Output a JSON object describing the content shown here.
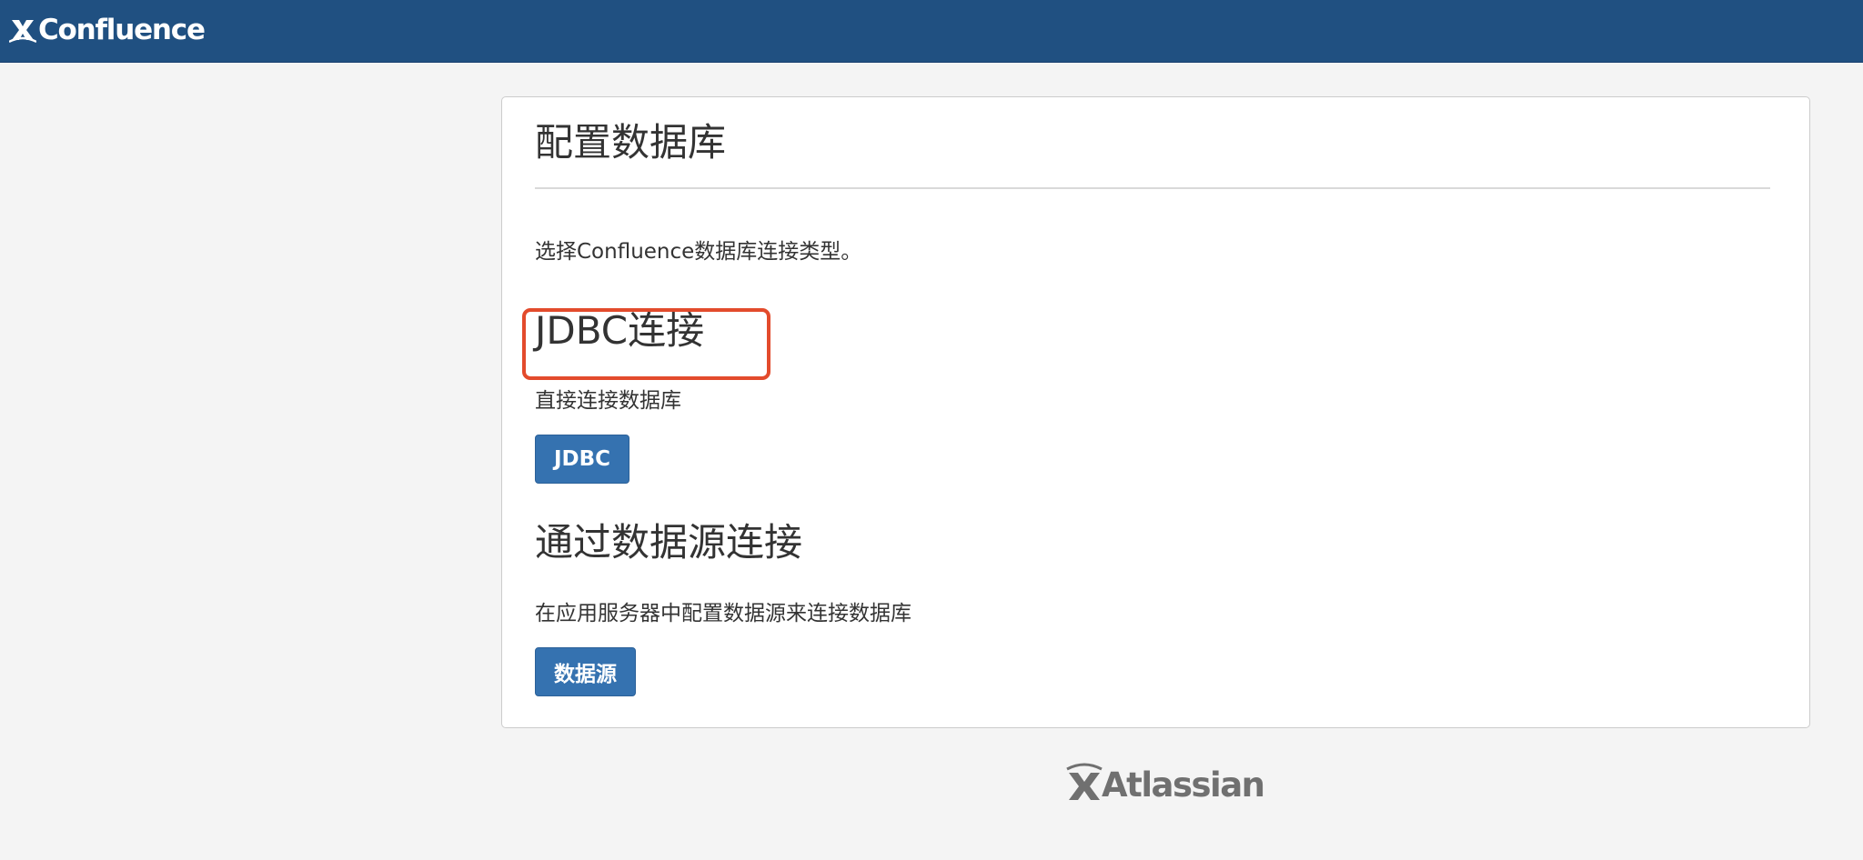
{
  "header": {
    "logo_text": "Confluence",
    "background_color": "#205081",
    "logo_icon": "confluence-x-icon"
  },
  "main": {
    "title": "配置数据库",
    "intro": "选择Confluence数据库连接类型。",
    "sections": [
      {
        "heading": "JDBC连接",
        "description": "直接连接数据库",
        "button_label": "JDBC",
        "highlighted": true,
        "highlight_color": "#e34b2c"
      },
      {
        "heading": "通过数据源连接",
        "description": "在应用服务器中配置数据源来连接数据库",
        "button_label": "数据源",
        "highlighted": false
      }
    ],
    "button_color": "#3572b0"
  },
  "footer": {
    "logo_text": "Atlassian",
    "logo_icon": "atlassian-x-icon"
  }
}
